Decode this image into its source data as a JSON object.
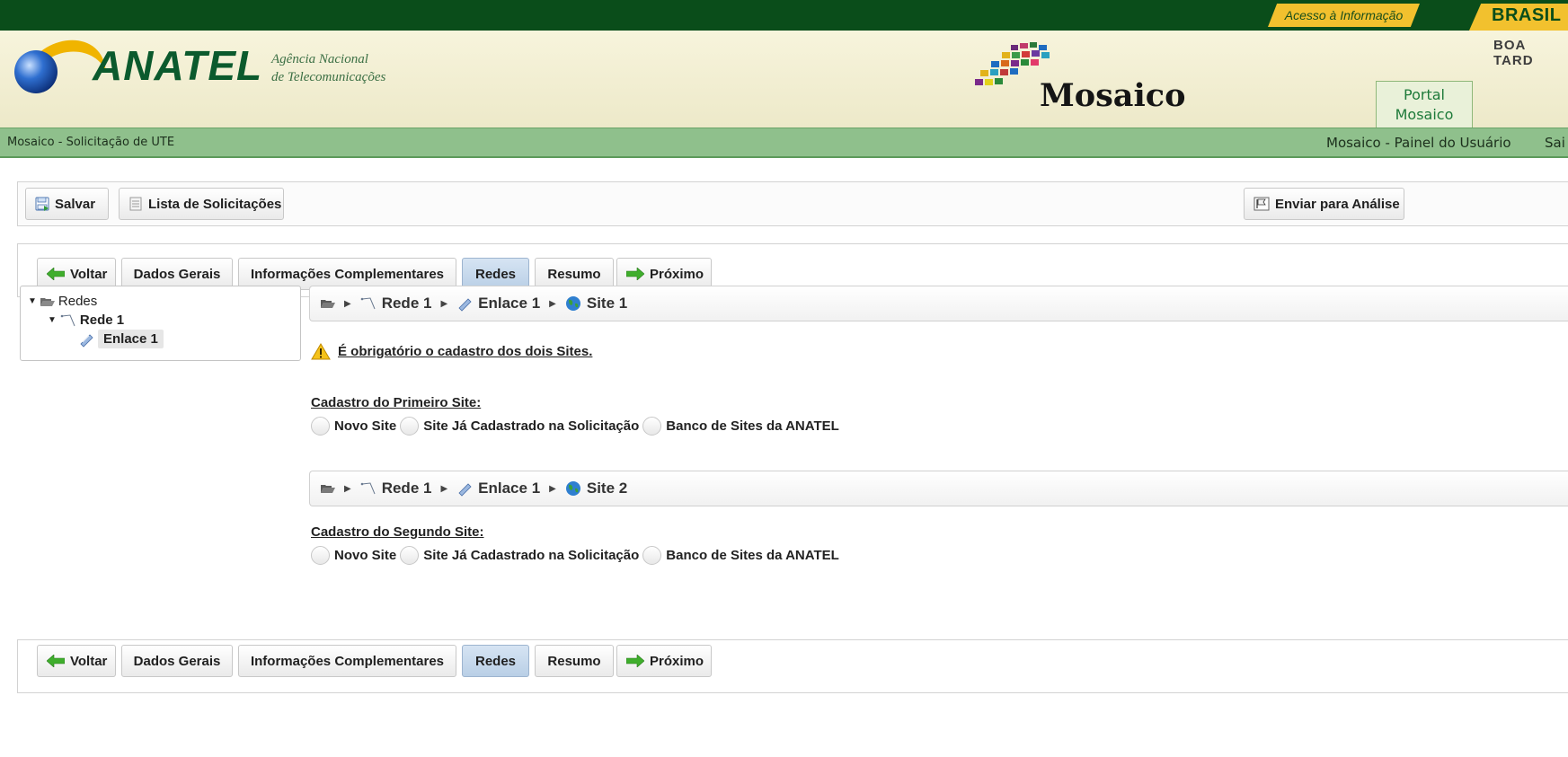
{
  "gov": {
    "access_link": "Acesso à Informação",
    "brasil": "BRASIL"
  },
  "header": {
    "brand": "ANATEL",
    "agency_line1": "Agência Nacional",
    "agency_line2": "de Telecomunicações",
    "app_name": "Mosaico",
    "greeting": "BOA TARD",
    "portal_line1": "Portal",
    "portal_line2": "Mosaico"
  },
  "breadcrumb": {
    "current": "Mosaico - Solicitação de UTE",
    "user_panel": "Mosaico - Painel do Usuário",
    "exit": "Sai"
  },
  "toolbar": {
    "save": "Salvar",
    "list": "Lista de Solicitações",
    "send": "Enviar para Análise"
  },
  "nav": {
    "back": "Voltar",
    "general": "Dados Gerais",
    "complementary": "Informações Complementares",
    "networks": "Redes",
    "summary": "Resumo",
    "next": "Próximo",
    "active": "Redes"
  },
  "tree": {
    "root": "Redes",
    "network": "Rede 1",
    "link": "Enlace 1"
  },
  "site1": {
    "path": [
      "Rede 1",
      "Enlace 1",
      "Site 1"
    ],
    "warning": "É obrigatório o cadastro dos dois Sites.",
    "title": "Cadastro do Primeiro Site:"
  },
  "site2": {
    "path": [
      "Rede 1",
      "Enlace 1",
      "Site 2"
    ],
    "title": "Cadastro do Segundo Site:"
  },
  "site_options": [
    "Novo Site",
    "Site Já Cadastrado na Solicitação",
    "Banco de Sites da ANATEL"
  ],
  "colors": {
    "gov_green": "#0a4d1a",
    "gov_yellow": "#f2c12e",
    "anatel_green": "#0b5a2d",
    "crumb_green": "#8fc08c",
    "active_tab": "#b9cfe6"
  }
}
